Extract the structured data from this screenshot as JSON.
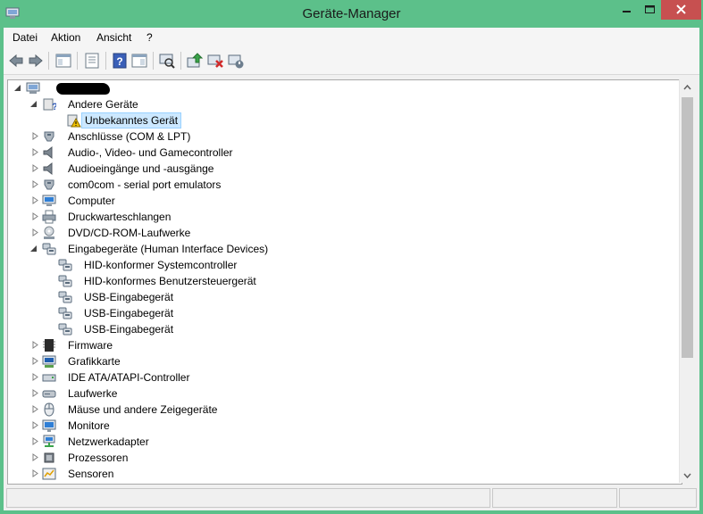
{
  "window": {
    "title": "Geräte-Manager",
    "frame_color": "#5cc08a",
    "close_color": "#c75050"
  },
  "menu": {
    "items": [
      "Datei",
      "Aktion",
      "Ansicht",
      "?"
    ]
  },
  "toolbar": {
    "buttons": [
      "back-icon",
      "forward-icon",
      "show-hide-console-tree-icon",
      "properties-icon",
      "help-icon",
      "action-pane-icon",
      "scan-hardware-icon",
      "update-driver-icon",
      "uninstall-device-icon",
      "disable-device-icon"
    ]
  },
  "tree": {
    "root": {
      "label_redacted": true
    },
    "nodes": [
      {
        "label": "Andere Geräte",
        "icon": "unknown-device-icon",
        "expanded": true
      },
      {
        "label": "Unbekanntes Gerät",
        "icon": "warning-device-icon",
        "selected": true
      },
      {
        "label": "Anschlüsse (COM & LPT)",
        "icon": "port-icon"
      },
      {
        "label": "Audio-, Video- und Gamecontroller",
        "icon": "speaker-icon"
      },
      {
        "label": "Audioeingänge und -ausgänge",
        "icon": "speaker-icon"
      },
      {
        "label": "com0com - serial port emulators",
        "icon": "port-icon"
      },
      {
        "label": "Computer",
        "icon": "computer-icon"
      },
      {
        "label": "Druckwarteschlangen",
        "icon": "printer-icon"
      },
      {
        "label": "DVD/CD-ROM-Laufwerke",
        "icon": "dvd-drive-icon"
      },
      {
        "label": "Eingabegeräte (Human Interface Devices)",
        "icon": "hid-icon",
        "expanded": true
      },
      {
        "label": "HID-konformer Systemcontroller",
        "icon": "hid-icon"
      },
      {
        "label": "HID-konformes Benutzersteuergerät",
        "icon": "hid-icon"
      },
      {
        "label": "USB-Eingabegerät",
        "icon": "hid-icon"
      },
      {
        "label": "USB-Eingabegerät",
        "icon": "hid-icon"
      },
      {
        "label": "USB-Eingabegerät",
        "icon": "hid-icon"
      },
      {
        "label": "Firmware",
        "icon": "firmware-icon"
      },
      {
        "label": "Grafikkarte",
        "icon": "display-adapter-icon"
      },
      {
        "label": "IDE ATA/ATAPI-Controller",
        "icon": "ide-controller-icon"
      },
      {
        "label": "Laufwerke",
        "icon": "disk-drive-icon"
      },
      {
        "label": "Mäuse und andere Zeigegeräte",
        "icon": "mouse-icon"
      },
      {
        "label": "Monitore",
        "icon": "monitor-icon"
      },
      {
        "label": "Netzwerkadapter",
        "icon": "network-adapter-icon"
      },
      {
        "label": "Prozessoren",
        "icon": "processor-icon"
      },
      {
        "label": "Sensoren",
        "icon": "sensor-icon"
      }
    ]
  }
}
